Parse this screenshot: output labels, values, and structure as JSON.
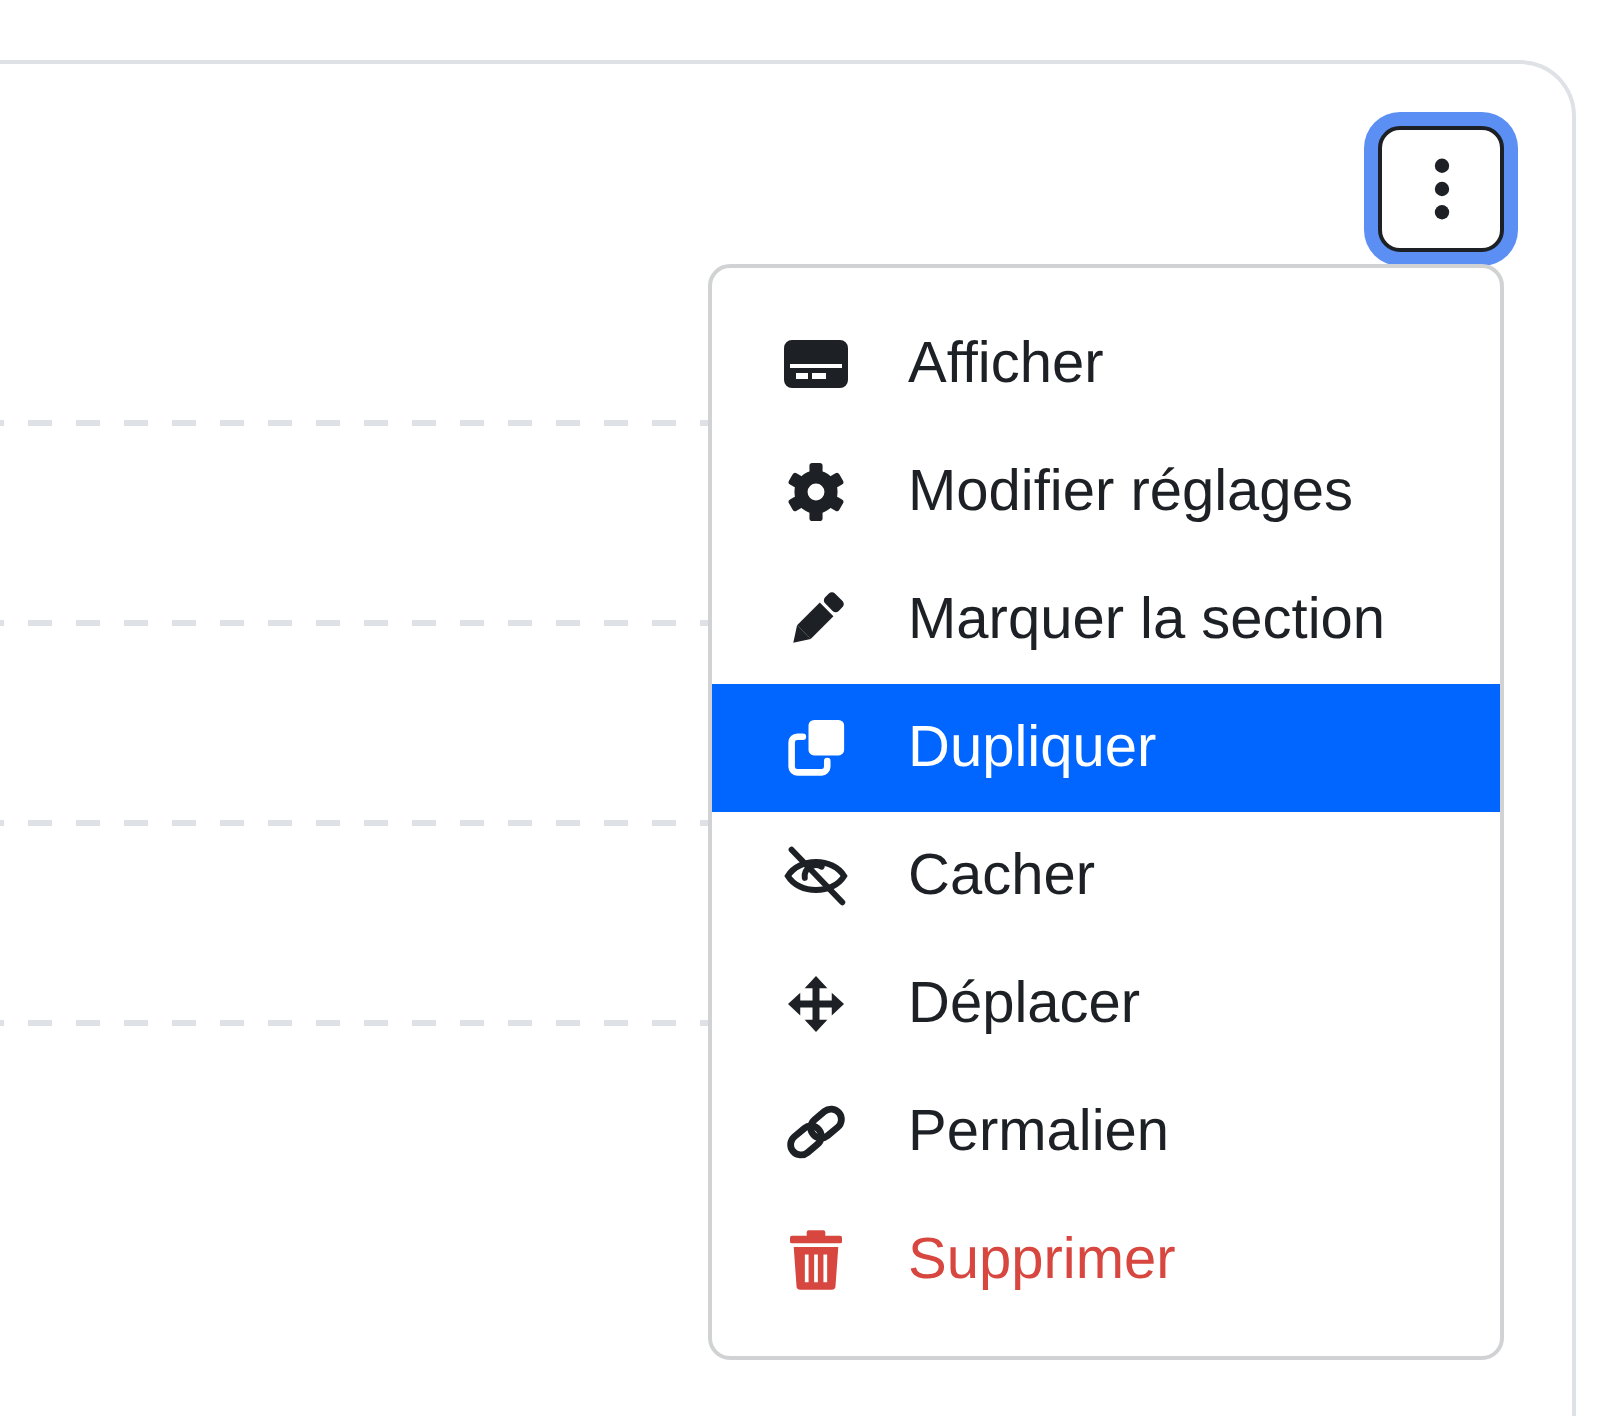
{
  "menu_button": {
    "focused": true
  },
  "menu": {
    "items": [
      {
        "label": "Afficher",
        "kind": "normal",
        "selected": false
      },
      {
        "label": "Modifier réglages",
        "kind": "normal",
        "selected": false
      },
      {
        "label": "Marquer la section",
        "kind": "normal",
        "selected": false
      },
      {
        "label": "Dupliquer",
        "kind": "normal",
        "selected": true
      },
      {
        "label": "Cacher",
        "kind": "normal",
        "selected": false
      },
      {
        "label": "Déplacer",
        "kind": "normal",
        "selected": false
      },
      {
        "label": "Permalien",
        "kind": "normal",
        "selected": false
      },
      {
        "label": "Supprimer",
        "kind": "danger",
        "selected": false
      }
    ]
  }
}
